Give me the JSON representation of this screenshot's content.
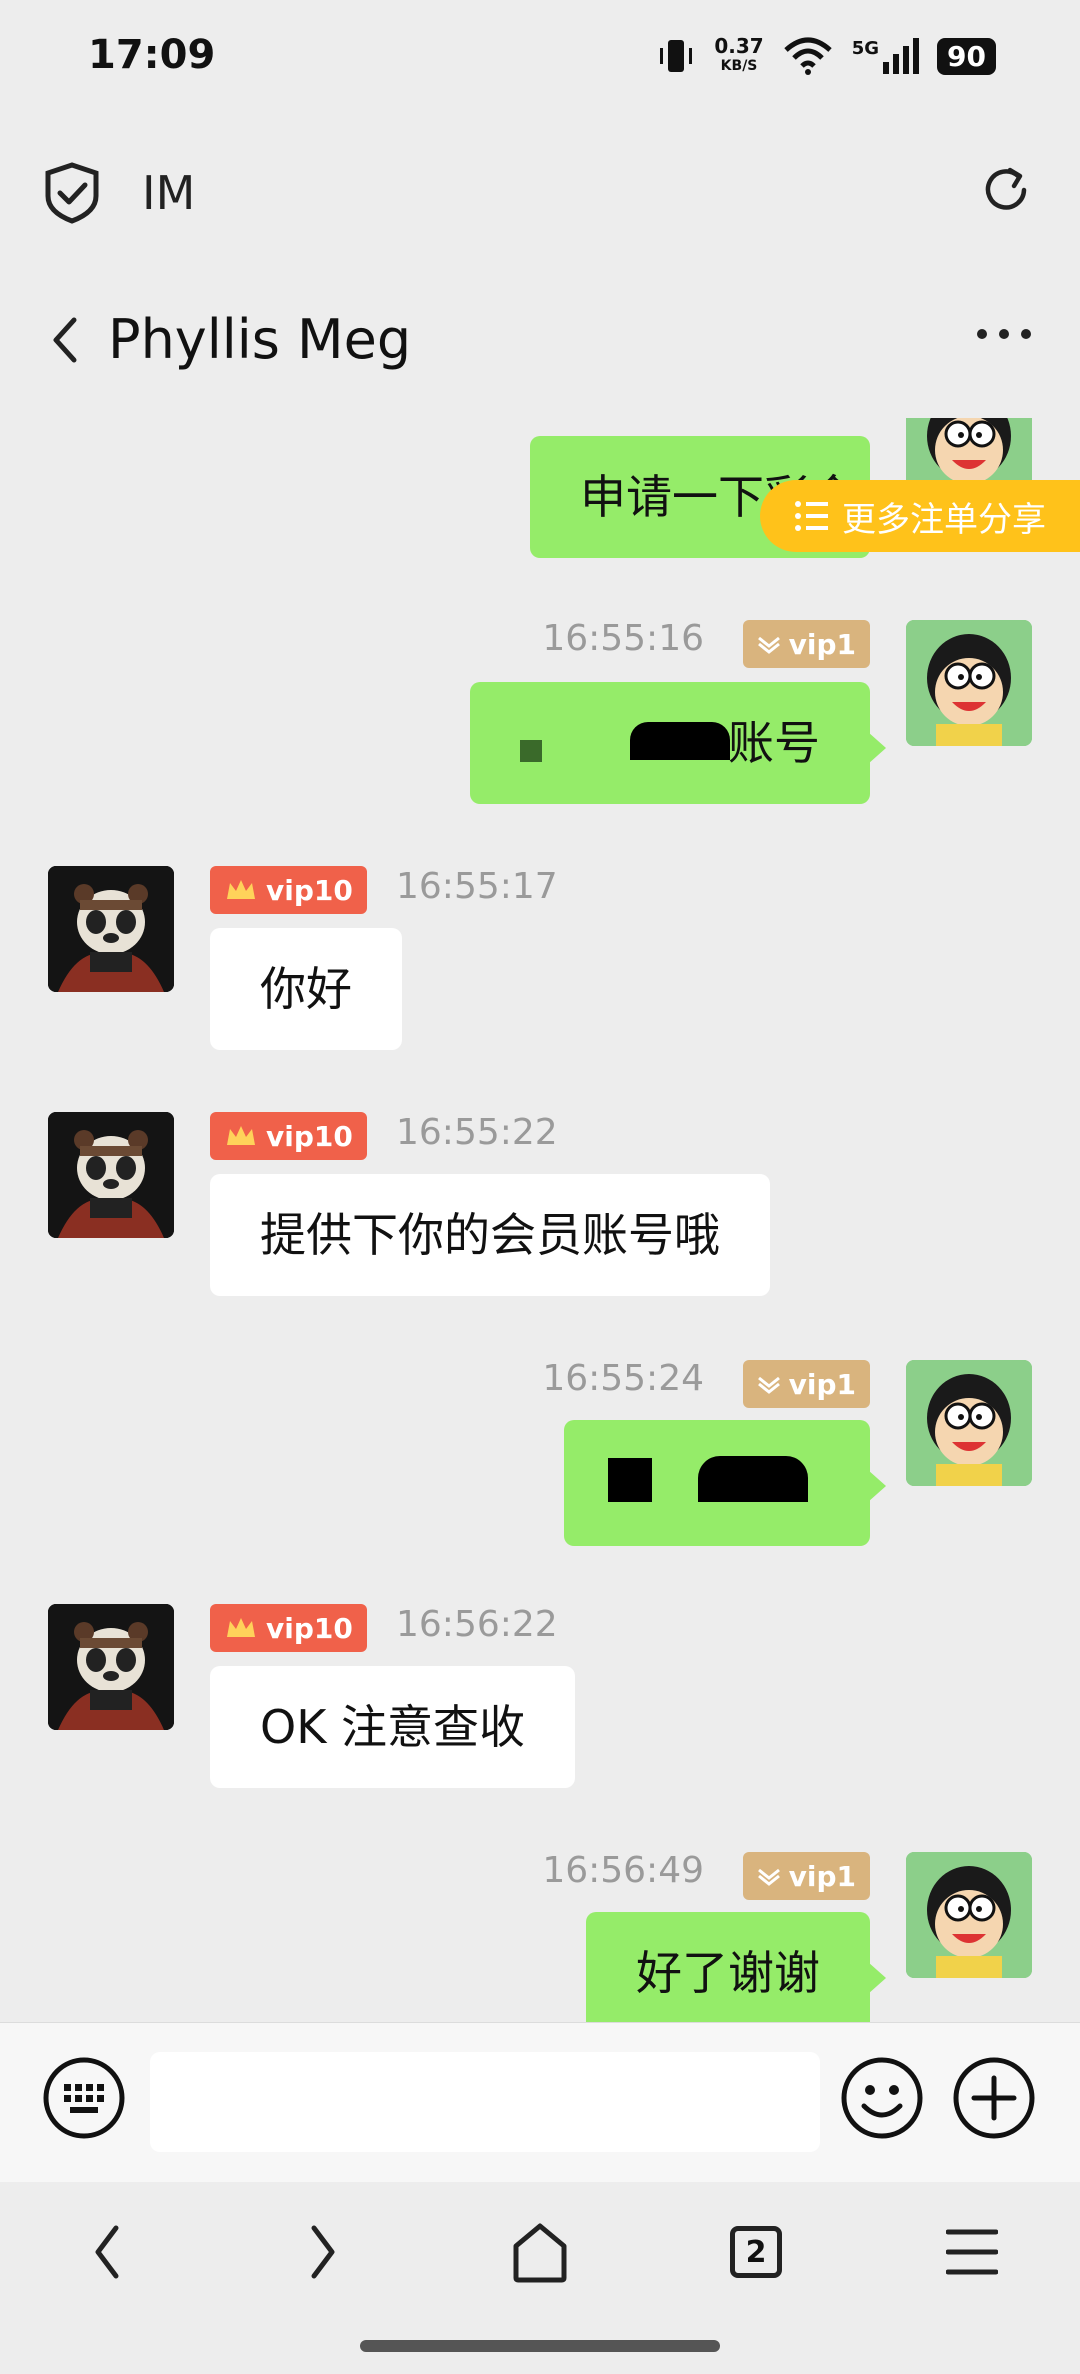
{
  "status_bar": {
    "time": "17:09",
    "net_speed_value": "0.37",
    "net_speed_unit": "KB/S",
    "network": "5G",
    "battery": "90"
  },
  "top_bar": {
    "title": "IM"
  },
  "chat": {
    "title": "Phyllis Meg"
  },
  "floating_button": {
    "label": "更多注单分享"
  },
  "messages": [
    {
      "side": "self",
      "text": "申请一下彩金"
    },
    {
      "side": "self",
      "time": "16:55:16",
      "badge": "vip1",
      "text": "账号"
    },
    {
      "side": "other",
      "time": "16:55:17",
      "badge": "vip10",
      "text": "你好"
    },
    {
      "side": "other",
      "time": "16:55:22",
      "badge": "vip10",
      "text": "提供下你的会员账号哦"
    },
    {
      "side": "self",
      "time": "16:55:24",
      "badge": "vip1",
      "text": ""
    },
    {
      "side": "other",
      "time": "16:56:22",
      "badge": "vip10",
      "text": "OK 注意查收"
    },
    {
      "side": "self",
      "time": "16:56:49",
      "badge": "vip1",
      "text": "好了谢谢"
    }
  ],
  "input": {
    "value": "",
    "placeholder": ""
  },
  "icons": {
    "shield": "shield-check-icon",
    "refresh": "refresh-icon",
    "back": "chevron-left-icon",
    "more": "more-horizontal-icon",
    "keyboard": "keyboard-icon",
    "emoji": "emoji-icon",
    "plus": "plus-icon"
  },
  "navbar": {
    "tabs_count": "2"
  },
  "colors": {
    "self_bubble": "#95ec69",
    "vip1_badge": "#d9b47e",
    "vip10_badge": "#f0614a",
    "share_button": "#ffc21a"
  }
}
